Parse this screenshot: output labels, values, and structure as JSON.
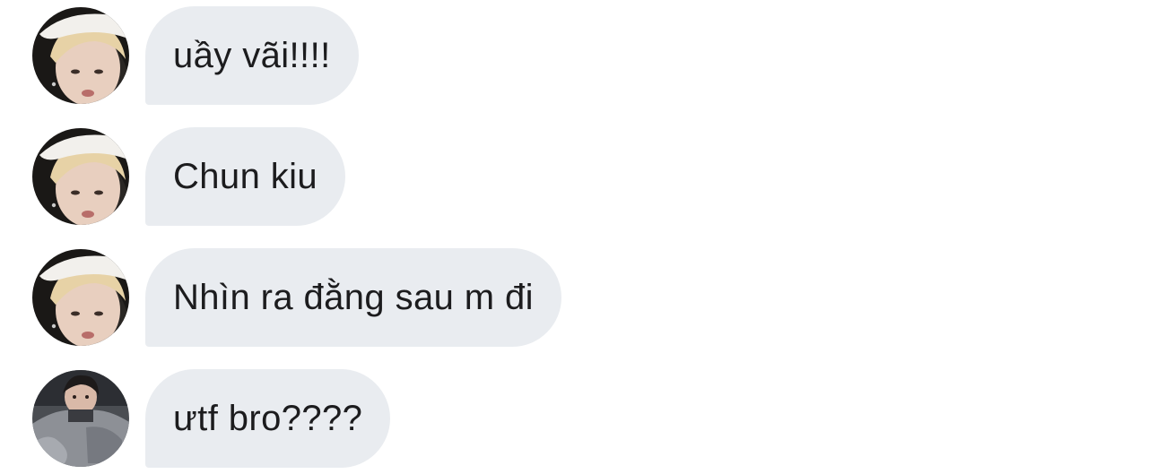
{
  "chat": {
    "messages": [
      {
        "text": "uầy vãi!!!!",
        "sender_avatar": "avatar-blond-white-cap"
      },
      {
        "text": "Chun kiu",
        "sender_avatar": "avatar-blond-white-cap"
      },
      {
        "text": "Nhìn ra đằng sau m đi",
        "sender_avatar": "avatar-blond-white-cap"
      },
      {
        "text": "ưtf bro????",
        "sender_avatar": "avatar-dark-hair-grey-jacket"
      }
    ],
    "bubble_color": "#e9ecf0",
    "text_color": "#1c1c1e"
  }
}
